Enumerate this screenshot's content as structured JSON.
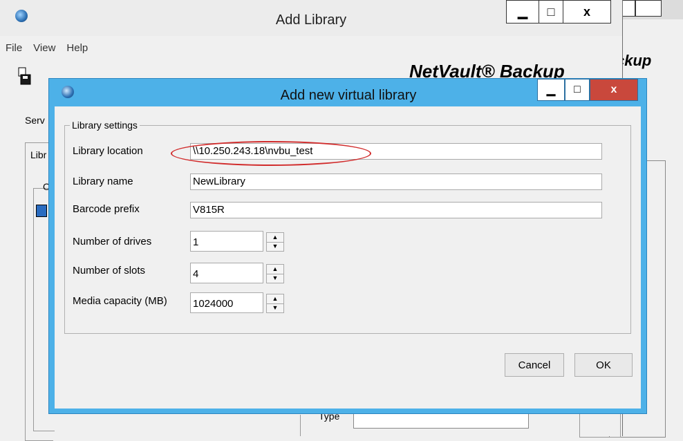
{
  "background_window": {
    "brand": "ckup"
  },
  "main_window": {
    "title": "Add Library",
    "controls": {
      "minimize": "▁",
      "maximize": "□",
      "close": "x"
    },
    "menu": [
      "File",
      "View",
      "Help"
    ],
    "brand": "NetVault® Backup",
    "left_labels": {
      "server": "Serv",
      "library_tab": "Libr",
      "tree_group": "O"
    },
    "type_label": "Type"
  },
  "dialog": {
    "title": "Add new virtual library",
    "controls": {
      "minimize": "▁",
      "maximize": "□",
      "close": "x"
    },
    "group_title": "Library settings",
    "fields": {
      "library_location": {
        "label": "Library location",
        "value": "\\\\10.250.243.18\\nvbu_test"
      },
      "library_name": {
        "label": "Library name",
        "value": "NewLibrary"
      },
      "barcode_prefix": {
        "label": "Barcode prefix",
        "value": "V815R"
      },
      "number_of_drives": {
        "label": "Number of drives",
        "value": "1"
      },
      "number_of_slots": {
        "label": "Number of slots",
        "value": "4"
      },
      "media_capacity": {
        "label": "Media capacity (MB)",
        "value": "1024000"
      }
    },
    "buttons": {
      "cancel": "Cancel",
      "ok": "OK"
    }
  },
  "colors": {
    "dialog_frame": "#4db1e8",
    "close_button": "#c9483c",
    "annotation": "#d12b2b"
  }
}
